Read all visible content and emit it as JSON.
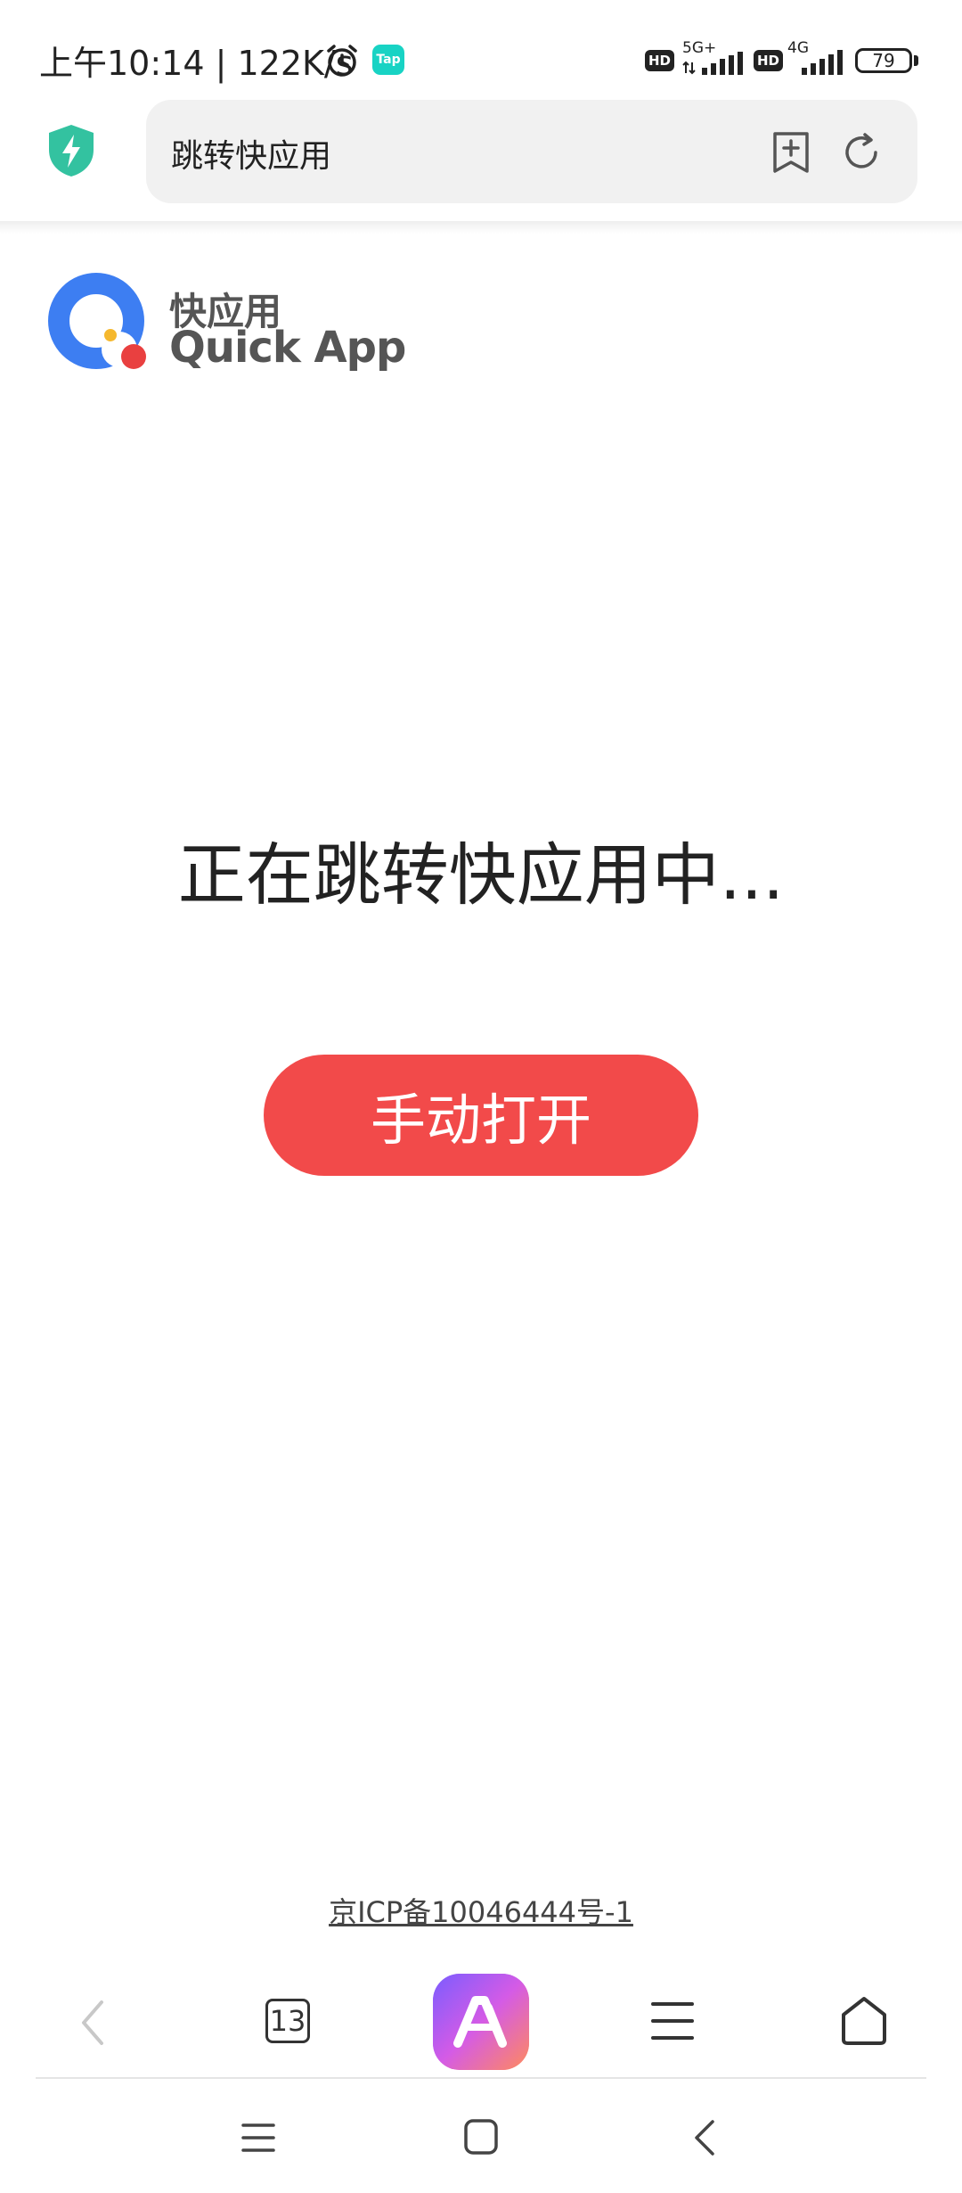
{
  "status_bar": {
    "time": "上午10:14 | 122K/s",
    "tap_badge": "Tap",
    "sim1": {
      "hd": "HD",
      "network": "5G+"
    },
    "sim2": {
      "hd": "HD",
      "network": "4G"
    },
    "battery": "79",
    "icons": [
      "alarm-icon",
      "tap-app-icon",
      "signal-icon",
      "battery-icon"
    ]
  },
  "browser": {
    "address": "跳转快应用",
    "icons": [
      "shield-icon",
      "bookmark-add-icon",
      "refresh-icon"
    ]
  },
  "logo": {
    "cn": "快应用",
    "en": "Quick App"
  },
  "main": {
    "message": "正在跳转快应用中...",
    "open_button": "手动打开"
  },
  "footer": {
    "icp": "京ICP备10046444号-1"
  },
  "toolbar": {
    "tab_count": "13",
    "icons": [
      "back-icon",
      "tabs-icon",
      "ai-assistant-icon",
      "menu-icon",
      "home-icon"
    ]
  },
  "colors": {
    "accent_red": "#f24a4a",
    "shield_green": "#33c2a0",
    "logo_blue": "#3d7ef2",
    "logo_red": "#e94040",
    "logo_yellow": "#f5b82e",
    "tap_teal": "#18d3c4"
  }
}
